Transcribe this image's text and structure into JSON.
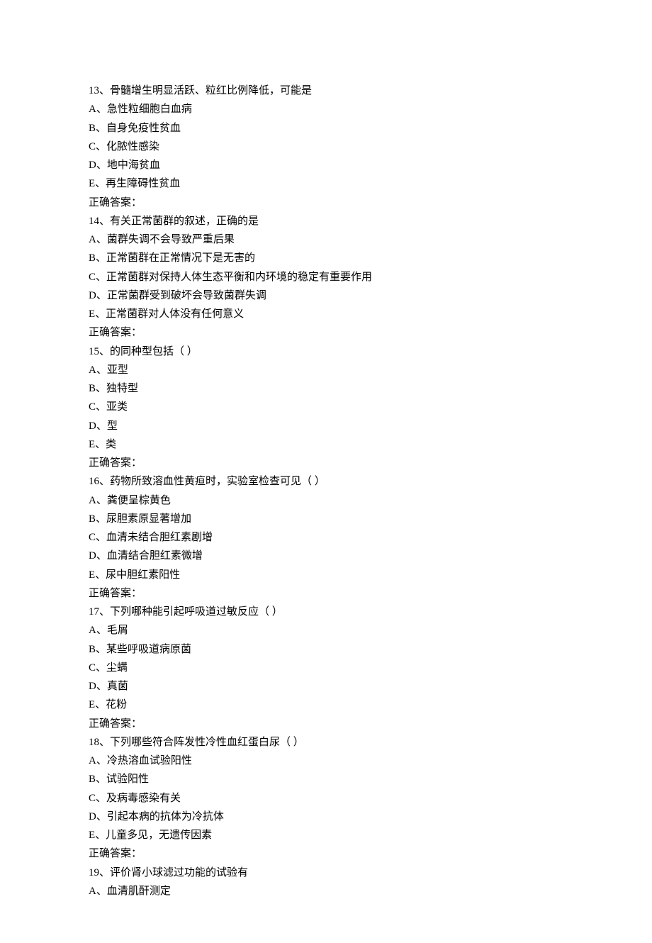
{
  "questions": [
    {
      "number": "13、",
      "text": "骨髓增生明显活跃、粒红比例降低，可能是",
      "options": [
        "A、急性粒细胞白血病",
        "B、自身免疫性贫血",
        "C、化脓性感染",
        "D、地中海贫血",
        "E、再生障碍性贫血"
      ],
      "answer_label": "正确答案："
    },
    {
      "number": "14、",
      "text": "有关正常菌群的叙述，正确的是",
      "options": [
        "A、菌群失调不会导致严重后果",
        "B、正常菌群在正常情况下是无害的",
        "C、正常菌群对保持人体生态平衡和内环境的稳定有重要作用",
        "D、正常菌群受到破坏会导致菌群失调",
        "E、正常菌群对人体没有任何意义"
      ],
      "answer_label": "正确答案："
    },
    {
      "number": "15、",
      "text": "的同种型包括（ ）",
      "options": [
        "A、亚型",
        "B、独特型",
        "C、亚类",
        "D、型",
        "E、类"
      ],
      "answer_label": "正确答案："
    },
    {
      "number": "16、",
      "text": "药物所致溶血性黄疸时，实验室检查可见（ ）",
      "options": [
        "A、粪便呈棕黄色",
        "B、尿胆素原显著增加",
        "C、血清未结合胆红素剧增",
        "D、血清结合胆红素微增",
        "E、尿中胆红素阳性"
      ],
      "answer_label": "正确答案："
    },
    {
      "number": "17、",
      "text": "下列哪种能引起呼吸道过敏反应（ ）",
      "options": [
        "A、毛屑",
        "B、某些呼吸道病原菌",
        "C、尘螨",
        "D、真菌",
        "E、花粉"
      ],
      "answer_label": "正确答案："
    },
    {
      "number": "18、",
      "text": "下列哪些符合阵发性冷性血红蛋白尿（ ）",
      "options": [
        "A、冷热溶血试验阳性",
        "B、试验阳性",
        "C、及病毒感染有关",
        "D、引起本病的抗体为冷抗体",
        "E、儿童多见，无遗传因素"
      ],
      "answer_label": "正确答案："
    },
    {
      "number": "19、",
      "text": "评价肾小球滤过功能的试验有",
      "options": [
        "A、血清肌酐测定"
      ],
      "answer_label": ""
    }
  ]
}
